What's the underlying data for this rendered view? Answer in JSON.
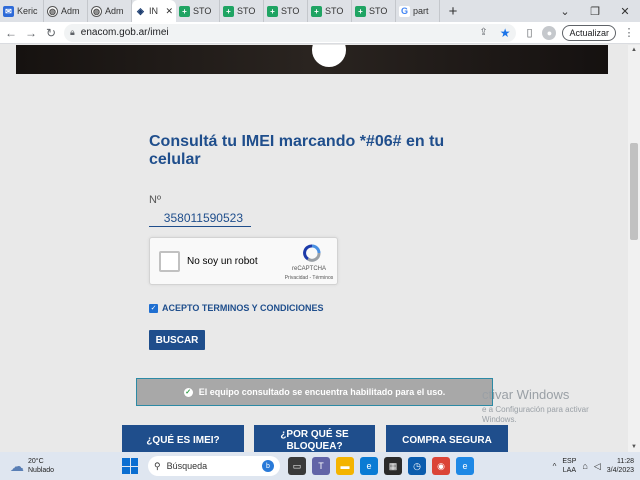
{
  "browser": {
    "tabs": [
      {
        "label": "Keric",
        "icon": "mail-icon"
      },
      {
        "label": "Adm",
        "icon": "globe-icon"
      },
      {
        "label": "Adm",
        "icon": "globe-icon"
      },
      {
        "label": "IN",
        "icon": "enacom-icon",
        "active": true
      },
      {
        "label": "STO",
        "icon": "sheets-icon"
      },
      {
        "label": "STO",
        "icon": "sheets-icon"
      },
      {
        "label": "STO",
        "icon": "sheets-icon"
      },
      {
        "label": "STO",
        "icon": "sheets-icon"
      },
      {
        "label": "STO",
        "icon": "sheets-icon"
      },
      {
        "label": "part",
        "icon": "google-icon"
      }
    ],
    "new_tab": "+",
    "url": "enacom.gob.ar/imei",
    "update_label": "Actualizar",
    "window_controls": {
      "minimize": "⌄",
      "restore": "❐",
      "close": "✕"
    }
  },
  "page": {
    "heading": "Consultá tu IMEI marcando *#06# en tu celular",
    "number_label": "Nº",
    "imei_value": "358011590523",
    "captcha": {
      "label": "No soy un robot",
      "brand": "reCAPTCHA",
      "links": "Privacidad - Términos"
    },
    "terms_label": "ACEPTO TERMINOS Y CONDICIONES",
    "terms_checked": true,
    "search_button": "BUSCAR",
    "status_message": "El equipo consultado se encuentra habilitado para el uso.",
    "status_color": "#2e9a45",
    "buttons": {
      "what_is_imei": "¿QUÉ ES IMEI?",
      "why_blocked": "¿POR QUÉ SE BLOQUEA?",
      "safe_purchase": "COMPRA SEGURA"
    },
    "accent_color": "#1f4e8c"
  },
  "windows_watermark": {
    "line1": "ctivar Windows",
    "line2": "e a Configuración para activar",
    "line3": "Windows."
  },
  "taskbar": {
    "weather_temp": "20°C",
    "weather_desc": "Nublado",
    "search_placeholder": "Búsqueda",
    "apps": [
      "task-view-icon",
      "teams-icon",
      "file-explorer-icon",
      "edge-icon",
      "store-icon",
      "clock-app-icon",
      "chrome-icon",
      "edge-dev-icon"
    ],
    "lang_line1": "ESP",
    "lang_line2": "LAA",
    "time": "11:28",
    "date": "3/4/2023"
  }
}
